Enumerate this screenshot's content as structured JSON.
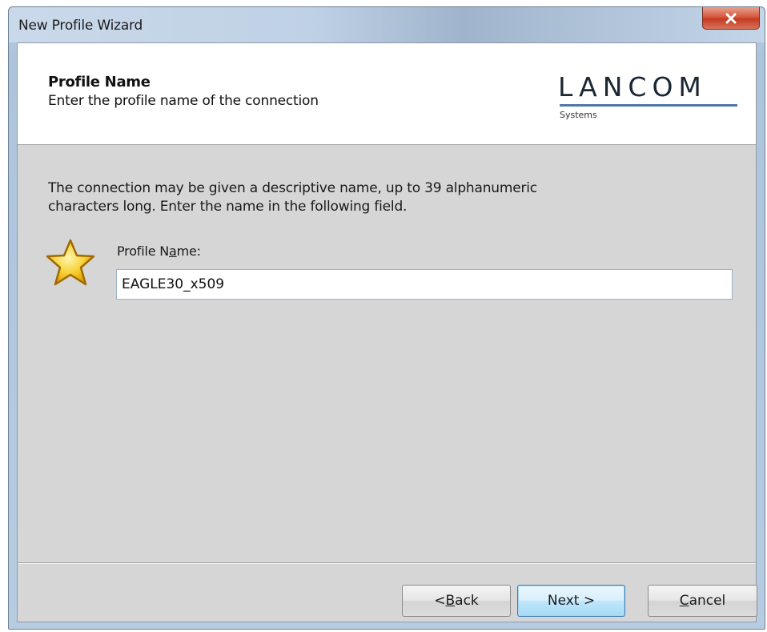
{
  "window": {
    "title": "New Profile Wizard"
  },
  "header": {
    "title": "Profile Name",
    "subtitle": "Enter the profile name of the connection",
    "logo": {
      "wordmark": "LANCOM",
      "subtitle": "Systems"
    }
  },
  "body": {
    "description_line1": "The connection may be given a descriptive name, up to 39 alphanumeric",
    "description_line2": "characters long. Enter the name in the following field.",
    "icon": "star-icon",
    "profile_name": {
      "label_prefix": "Profile N",
      "label_mnemonic": "a",
      "label_suffix": "me:",
      "value": "EAGLE30_x509"
    }
  },
  "buttons": {
    "back": {
      "prefix": "< ",
      "mnemonic": "B",
      "suffix": "ack"
    },
    "next": {
      "label": "Next >"
    },
    "cancel": {
      "mnemonic": "C",
      "suffix": "ancel"
    }
  },
  "colors": {
    "accent": "#4e78a8",
    "dialog_bg": "#d6d6d6",
    "close_button": "#c53b22",
    "star": "#f5c518"
  }
}
